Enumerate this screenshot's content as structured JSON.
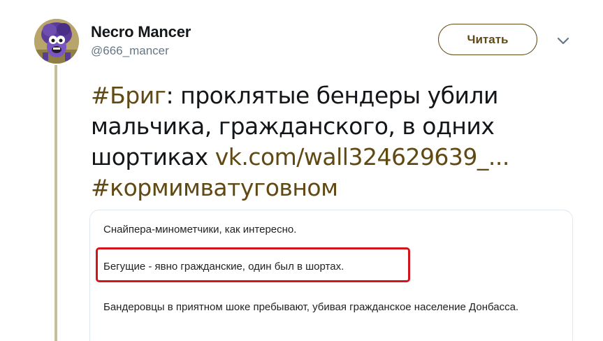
{
  "author": {
    "name": "Necro Mancer",
    "handle": "@666_mancer",
    "avatar_icon": "purple-monster-avatar"
  },
  "actions": {
    "follow_label": "Читать",
    "more_icon": "chevron-down-icon"
  },
  "tweet": {
    "hashtag_1": "#Бриг",
    "line1_rest": ": проклятые бендеры убили",
    "line2": "мальчика, гражданского, в одних",
    "line3_text": "шортиках ",
    "link": "vk.com/wall324629639_...",
    "hashtag_2": "#кормимватуговном"
  },
  "card": {
    "line1": "Снайпера-минометчики, как интересно.",
    "highlighted": "Бегущие - явно гражданские, один был в шортах.",
    "paragraph": "Бандеровцы в приятном шоке пребывают, убивая гражданское население Донбасса."
  },
  "colors": {
    "link": "#604913",
    "highlight_border": "#d0161b",
    "thread_line": "#c4c09a"
  }
}
